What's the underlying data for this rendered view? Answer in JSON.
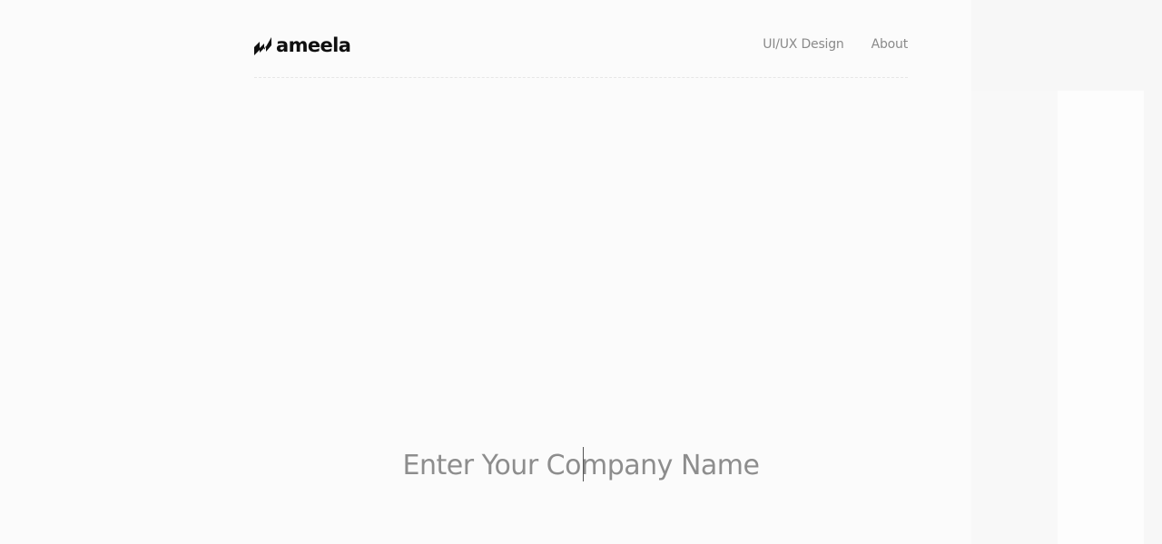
{
  "brand": {
    "name": "ameela",
    "logo_icon": "ameela-mark-icon",
    "logo_color": "#0f0f0f"
  },
  "nav": {
    "items": [
      {
        "label": "UI/UX Design"
      },
      {
        "label": "About"
      }
    ],
    "text_color": "#8a8a8a"
  },
  "company_field": {
    "value": "",
    "placeholder": "Enter Your Company Name",
    "focused": true,
    "text_color": "#8d8d8d"
  },
  "colors": {
    "background": "#fbfbfb",
    "divider": "#e6e6e6"
  }
}
